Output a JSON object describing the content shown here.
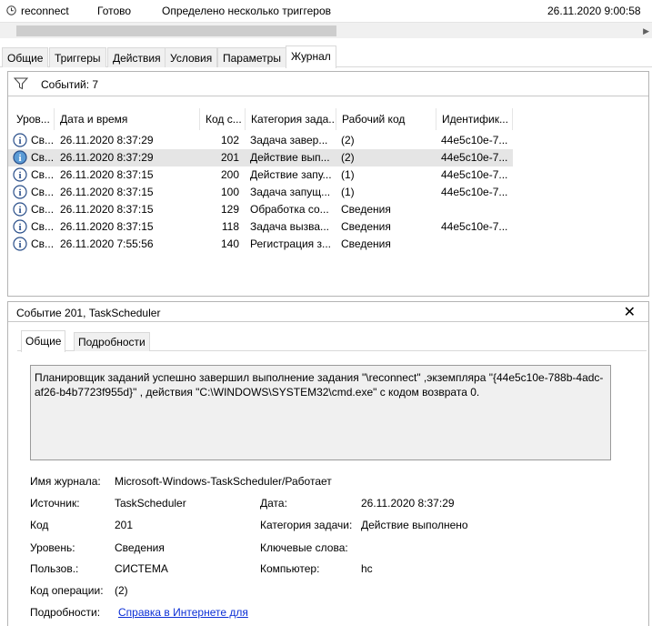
{
  "task": {
    "name": "reconnect",
    "status": "Готово",
    "triggers": "Определено несколько триггеров",
    "next_run": "26.11.2020 9:00:58"
  },
  "tabs": [
    {
      "label": "Общие"
    },
    {
      "label": "Триггеры"
    },
    {
      "label": "Действия"
    },
    {
      "label": "Условия"
    },
    {
      "label": "Параметры"
    },
    {
      "label": "Журнал"
    }
  ],
  "journal": {
    "events_count": "Событий: 7",
    "columns": [
      "Уров...",
      "Дата и время",
      "Код с...",
      "Категория зада...",
      "Рабочий код",
      "Идентифик..."
    ],
    "rows": [
      {
        "level": "Св...",
        "datetime": "26.11.2020 8:37:29",
        "code": "102",
        "category": "Задача завер...",
        "opcode": "(2)",
        "id": "44e5c10e-7..."
      },
      {
        "level": "Св...",
        "datetime": "26.11.2020 8:37:29",
        "code": "201",
        "category": "Действие вып...",
        "opcode": "(2)",
        "id": "44e5c10e-7..."
      },
      {
        "level": "Св...",
        "datetime": "26.11.2020 8:37:15",
        "code": "200",
        "category": "Действие запу...",
        "opcode": "(1)",
        "id": "44e5c10e-7..."
      },
      {
        "level": "Св...",
        "datetime": "26.11.2020 8:37:15",
        "code": "100",
        "category": "Задача запущ...",
        "opcode": "(1)",
        "id": "44e5c10e-7..."
      },
      {
        "level": "Св...",
        "datetime": "26.11.2020 8:37:15",
        "code": "129",
        "category": "Обработка со...",
        "opcode": "Сведения",
        "id": ""
      },
      {
        "level": "Св...",
        "datetime": "26.11.2020 8:37:15",
        "code": "118",
        "category": "Задача вызва...",
        "opcode": "Сведения",
        "id": "44e5c10e-7..."
      },
      {
        "level": "Св...",
        "datetime": "26.11.2020 7:55:56",
        "code": "140",
        "category": "Регистрация з...",
        "opcode": "Сведения",
        "id": ""
      }
    ]
  },
  "details": {
    "title": "Событие 201, TaskScheduler",
    "close": "✕",
    "tabs": [
      "Общие",
      "Подробности"
    ],
    "message_line1": "Планировщик заданий успешно завершил выполнение задания \"\\reconnect\" ,экземпляра \"{44e5c10e-788b-4adc-",
    "message_line2": "af26-b4b7723f955d}\" , действия \"C:\\WINDOWS\\SYSTEM32\\cmd.exe\" с кодом возврата 0.",
    "log_name_label": "Имя журнала:",
    "log_name_value": "Microsoft-Windows-TaskScheduler/Работает",
    "source_label": "Источник:",
    "source_value": "TaskScheduler",
    "date_label": "Дата:",
    "date_value": "26.11.2020 8:37:29",
    "code_label": "Код",
    "code_value": "201",
    "category_label": "Категория задачи:",
    "category_value": "Действие выполнено",
    "level_label": "Уровень:",
    "level_value": "Сведения",
    "keywords_label": "Ключевые слова:",
    "keywords_value": "",
    "user_label": "Пользов.:",
    "user_value": "СИСТЕМА",
    "computer_label": "Компьютер:",
    "computer_value": "hc",
    "opcode_label": "Код операции:",
    "opcode_value": "(2)",
    "more_label": "Подробности:",
    "more_link": "Справка в Интернете для"
  }
}
